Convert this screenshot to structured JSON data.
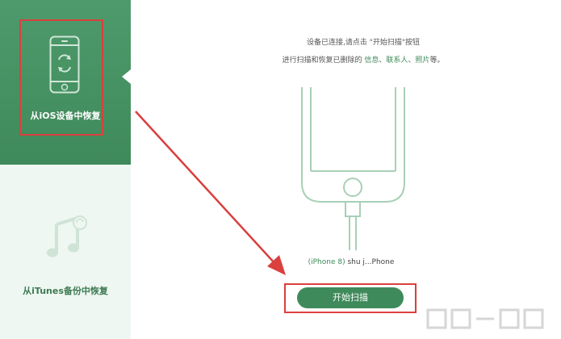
{
  "sidebar": {
    "items": [
      {
        "label": "从iOS设备中恢复",
        "icon": "phone-restore-icon",
        "active": true
      },
      {
        "label": "从iTunes备份中恢复",
        "icon": "music-note-icon",
        "active": false
      }
    ]
  },
  "main": {
    "instruction_line1_pre": "设备已连接,请点击 \"",
    "instruction_button_ref": "开始扫描",
    "instruction_line1_post": "\"按钮",
    "instruction_line2_pre": "进行扫描和恢复已删除的 ",
    "instruction_items": [
      "信息",
      "联系人",
      "照片"
    ],
    "instruction_sep1": "、",
    "instruction_sep2": "、",
    "instruction_line2_post": "等。",
    "device_model": "(iPhone 8)",
    "device_name": " shu j...Phone",
    "scan_button_label": "开始扫描"
  },
  "colors": {
    "brand": "#3f8a5a",
    "highlight": "#d9403e"
  }
}
